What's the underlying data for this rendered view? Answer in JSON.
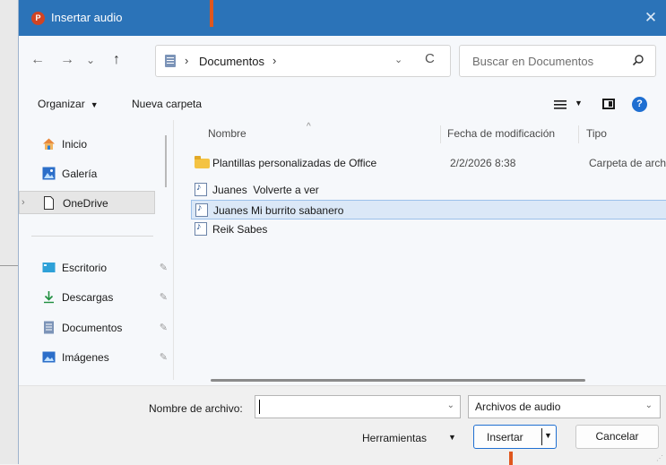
{
  "window": {
    "title": "Insertar audio",
    "app_icon_letter": "P",
    "close_glyph": "✕"
  },
  "nav": {
    "back": "←",
    "forward": "→",
    "recent": "⌄",
    "up": "↑"
  },
  "address": {
    "separator": "›",
    "path": "Documentos",
    "dropdown": "⌄",
    "refresh": "C"
  },
  "search": {
    "placeholder": "Buscar en Documentos"
  },
  "toolbar": {
    "organize": "Organizar",
    "new_folder": "Nueva carpeta"
  },
  "sidebar": {
    "items": [
      {
        "label": "Inicio"
      },
      {
        "label": "Galería"
      },
      {
        "label": "OneDrive"
      },
      {
        "label": "Escritorio"
      },
      {
        "label": "Descargas"
      },
      {
        "label": "Documentos"
      },
      {
        "label": "Imágenes"
      }
    ]
  },
  "columns": {
    "name": "Nombre",
    "date": "Fecha de modificación",
    "type": "Tipo"
  },
  "files": [
    {
      "name": "Plantillas personalizadas de Office",
      "date": "2/2/2026 8:38",
      "type": "Carpeta de arch"
    },
    {
      "name": "Juanes  Volverte a ver",
      "date": "",
      "type": ""
    },
    {
      "name": "Juanes Mi burrito sabanero",
      "date": "",
      "type": ""
    },
    {
      "name": "Reik Sabes",
      "date": "",
      "type": ""
    }
  ],
  "footer": {
    "filename_label": "Nombre de archivo:",
    "filename_value": "",
    "filter_value": "Archivos de audio",
    "tools": "Herramientas",
    "insert": "Insertar",
    "cancel": "Cancelar"
  },
  "colors": {
    "titlebar": "#2b73b8",
    "accent": "#1f6fd1",
    "selection": "#dbe8f7",
    "marker": "#e0571e"
  }
}
